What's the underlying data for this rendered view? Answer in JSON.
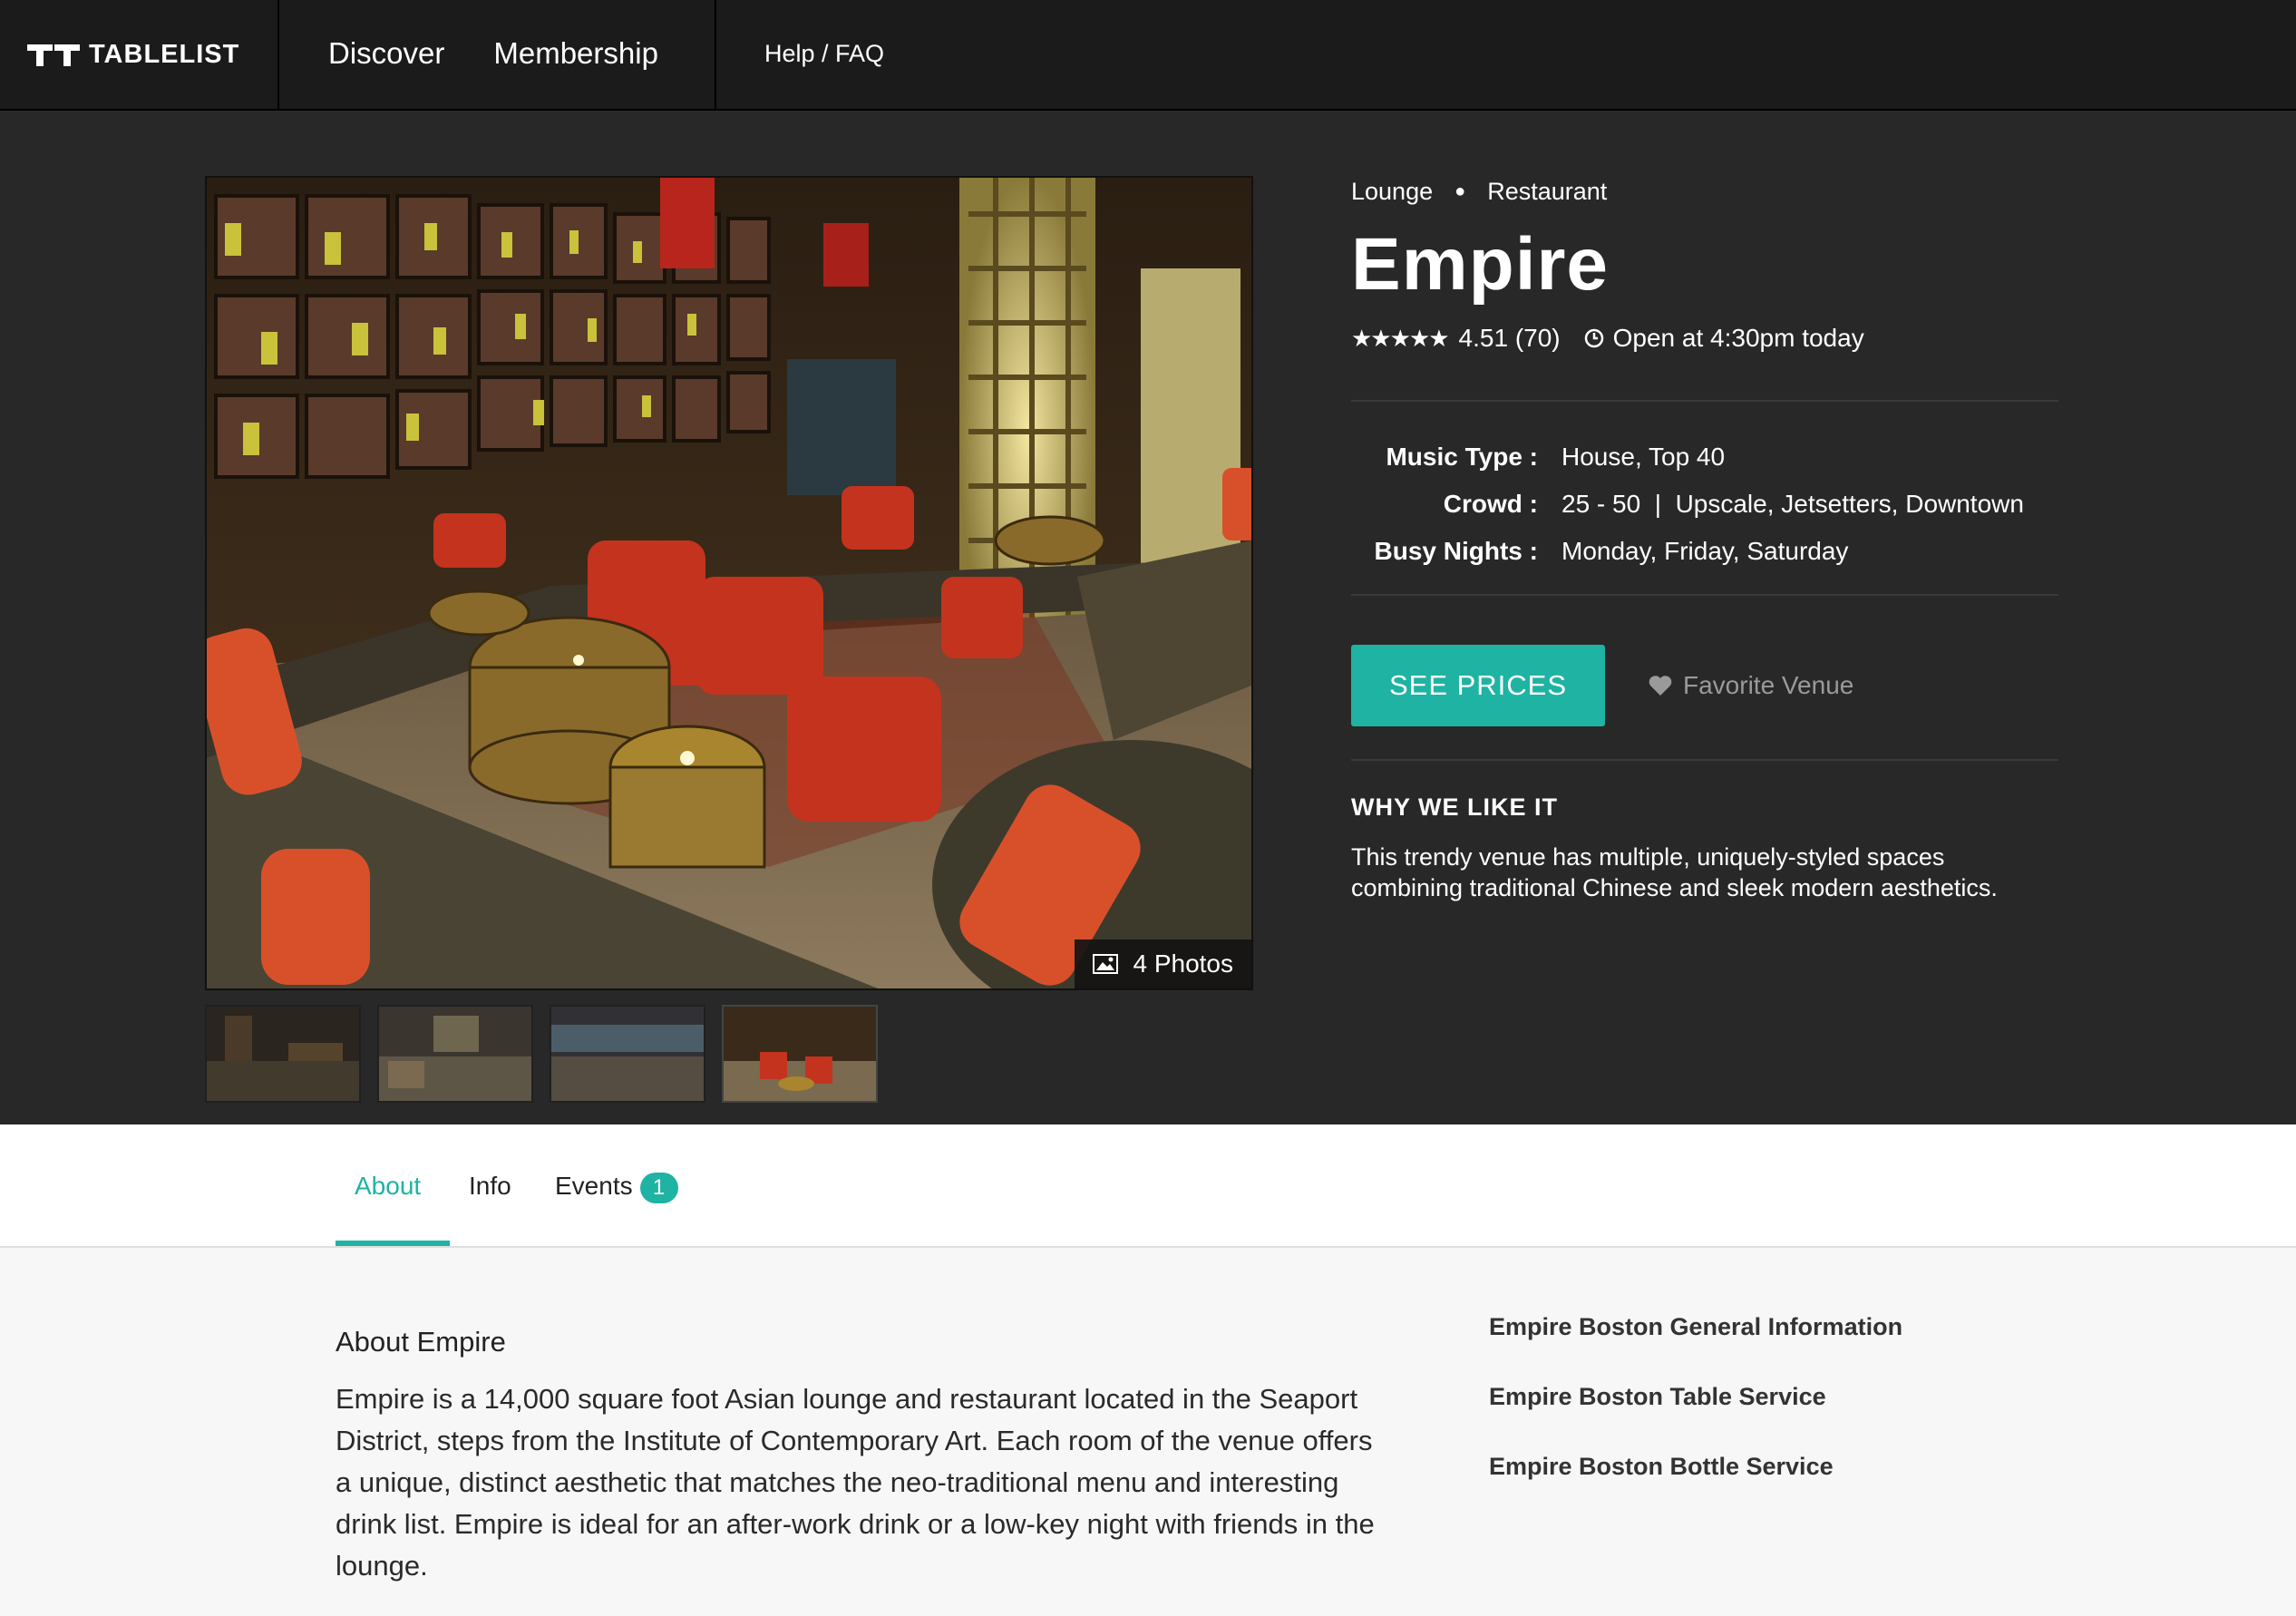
{
  "nav": {
    "logo_text": "TABLELIST",
    "links": [
      "Discover",
      "Membership"
    ],
    "help": "Help / FAQ"
  },
  "venue": {
    "categories": [
      "Lounge",
      "Restaurant"
    ],
    "name": "Empire",
    "stars_glyph": "★★★★★",
    "rating": "4.51 (70)",
    "open_text": "Open at 4:30pm today",
    "rating_value": 4.51,
    "facts": [
      {
        "label": "Music Type :",
        "value": "House, Top 40"
      },
      {
        "label": "Crowd :",
        "value": "25 - 50  |  Upscale, Jetsetters, Downtown"
      },
      {
        "label": "Busy Nights :",
        "value": "Monday, Friday, Saturday"
      }
    ],
    "cta_label": "SEE PRICES",
    "favorite_label": "Favorite Venue",
    "why_title": "WHY WE LIKE IT",
    "why_text": "This trendy venue has multiple, uniquely-styled spaces combining traditional Chinese and sleek modern aesthetics.",
    "photos_label": "4 Photos"
  },
  "tabs": [
    {
      "label": "About",
      "active": true
    },
    {
      "label": "Info",
      "active": false
    },
    {
      "label": "Events",
      "active": false,
      "badge": "1"
    }
  ],
  "about": {
    "title": "About Empire",
    "body": "Empire is a 14,000 square foot Asian lounge and restaurant located in the Seaport District, steps from the Institute of Contemporary Art. Each room of the venue offers a unique, distinct aesthetic that matches the neo-traditional menu and interesting drink list. Empire is ideal for an after-work drink or a low-key night with friends in the lounge."
  },
  "side_links": [
    "Empire Boston General Information",
    "Empire Boston Table Service",
    "Empire Boston Bottle Service"
  ],
  "colors": {
    "accent": "#1fb3a3",
    "nav_bg": "#1b1b1b",
    "hero_bg": "#282828"
  }
}
